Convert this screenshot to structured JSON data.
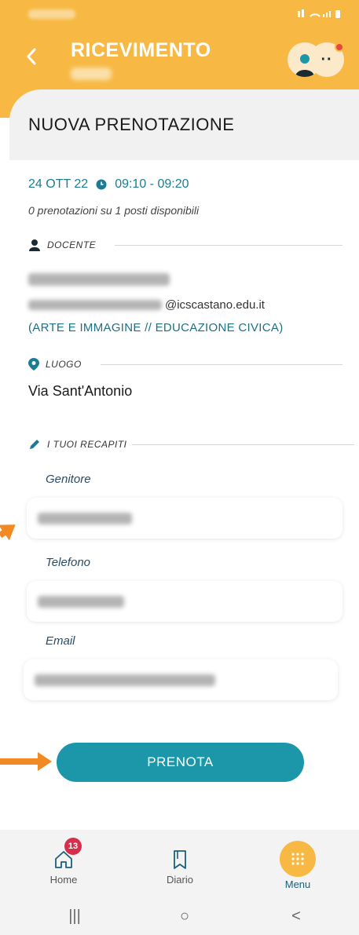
{
  "header": {
    "title": "RICEVIMENTO",
    "background_color": "#f7b943",
    "more_label": "··"
  },
  "page": {
    "section_title": "NUOVA PRENOTAZIONE"
  },
  "slot": {
    "date": "24 OTT 22",
    "time": "09:10 - 09:20",
    "availability": "0 prenotazioni su 1 posti disponibili"
  },
  "teacher": {
    "section_label": "DOCENTE",
    "email_domain": "@icscastano.edu.it",
    "subjects": "(ARTE E IMMAGINE // EDUCAZIONE CIVICA)"
  },
  "location": {
    "section_label": "LUOGO",
    "value": "Via Sant'Antonio"
  },
  "contacts": {
    "section_label": "I TUOI RECAPITI",
    "fields": [
      {
        "label": "Genitore"
      },
      {
        "label": "Telefono"
      },
      {
        "label": "Email"
      }
    ]
  },
  "submit": {
    "label": "PRENOTA",
    "color": "#1b97a9"
  },
  "bottom_nav": {
    "items": [
      {
        "label": "Home",
        "icon": "home-icon",
        "badge": "13"
      },
      {
        "label": "Diario",
        "icon": "diary-icon"
      },
      {
        "label": "Menu",
        "icon": "menu-grid-icon"
      }
    ]
  },
  "system_nav": {
    "recents_glyph": "|||",
    "home_glyph": "○",
    "back_glyph": "<"
  },
  "colors": {
    "accent": "#1b7d94",
    "arrow": "#f28a24",
    "badge": "#d62f4b"
  }
}
